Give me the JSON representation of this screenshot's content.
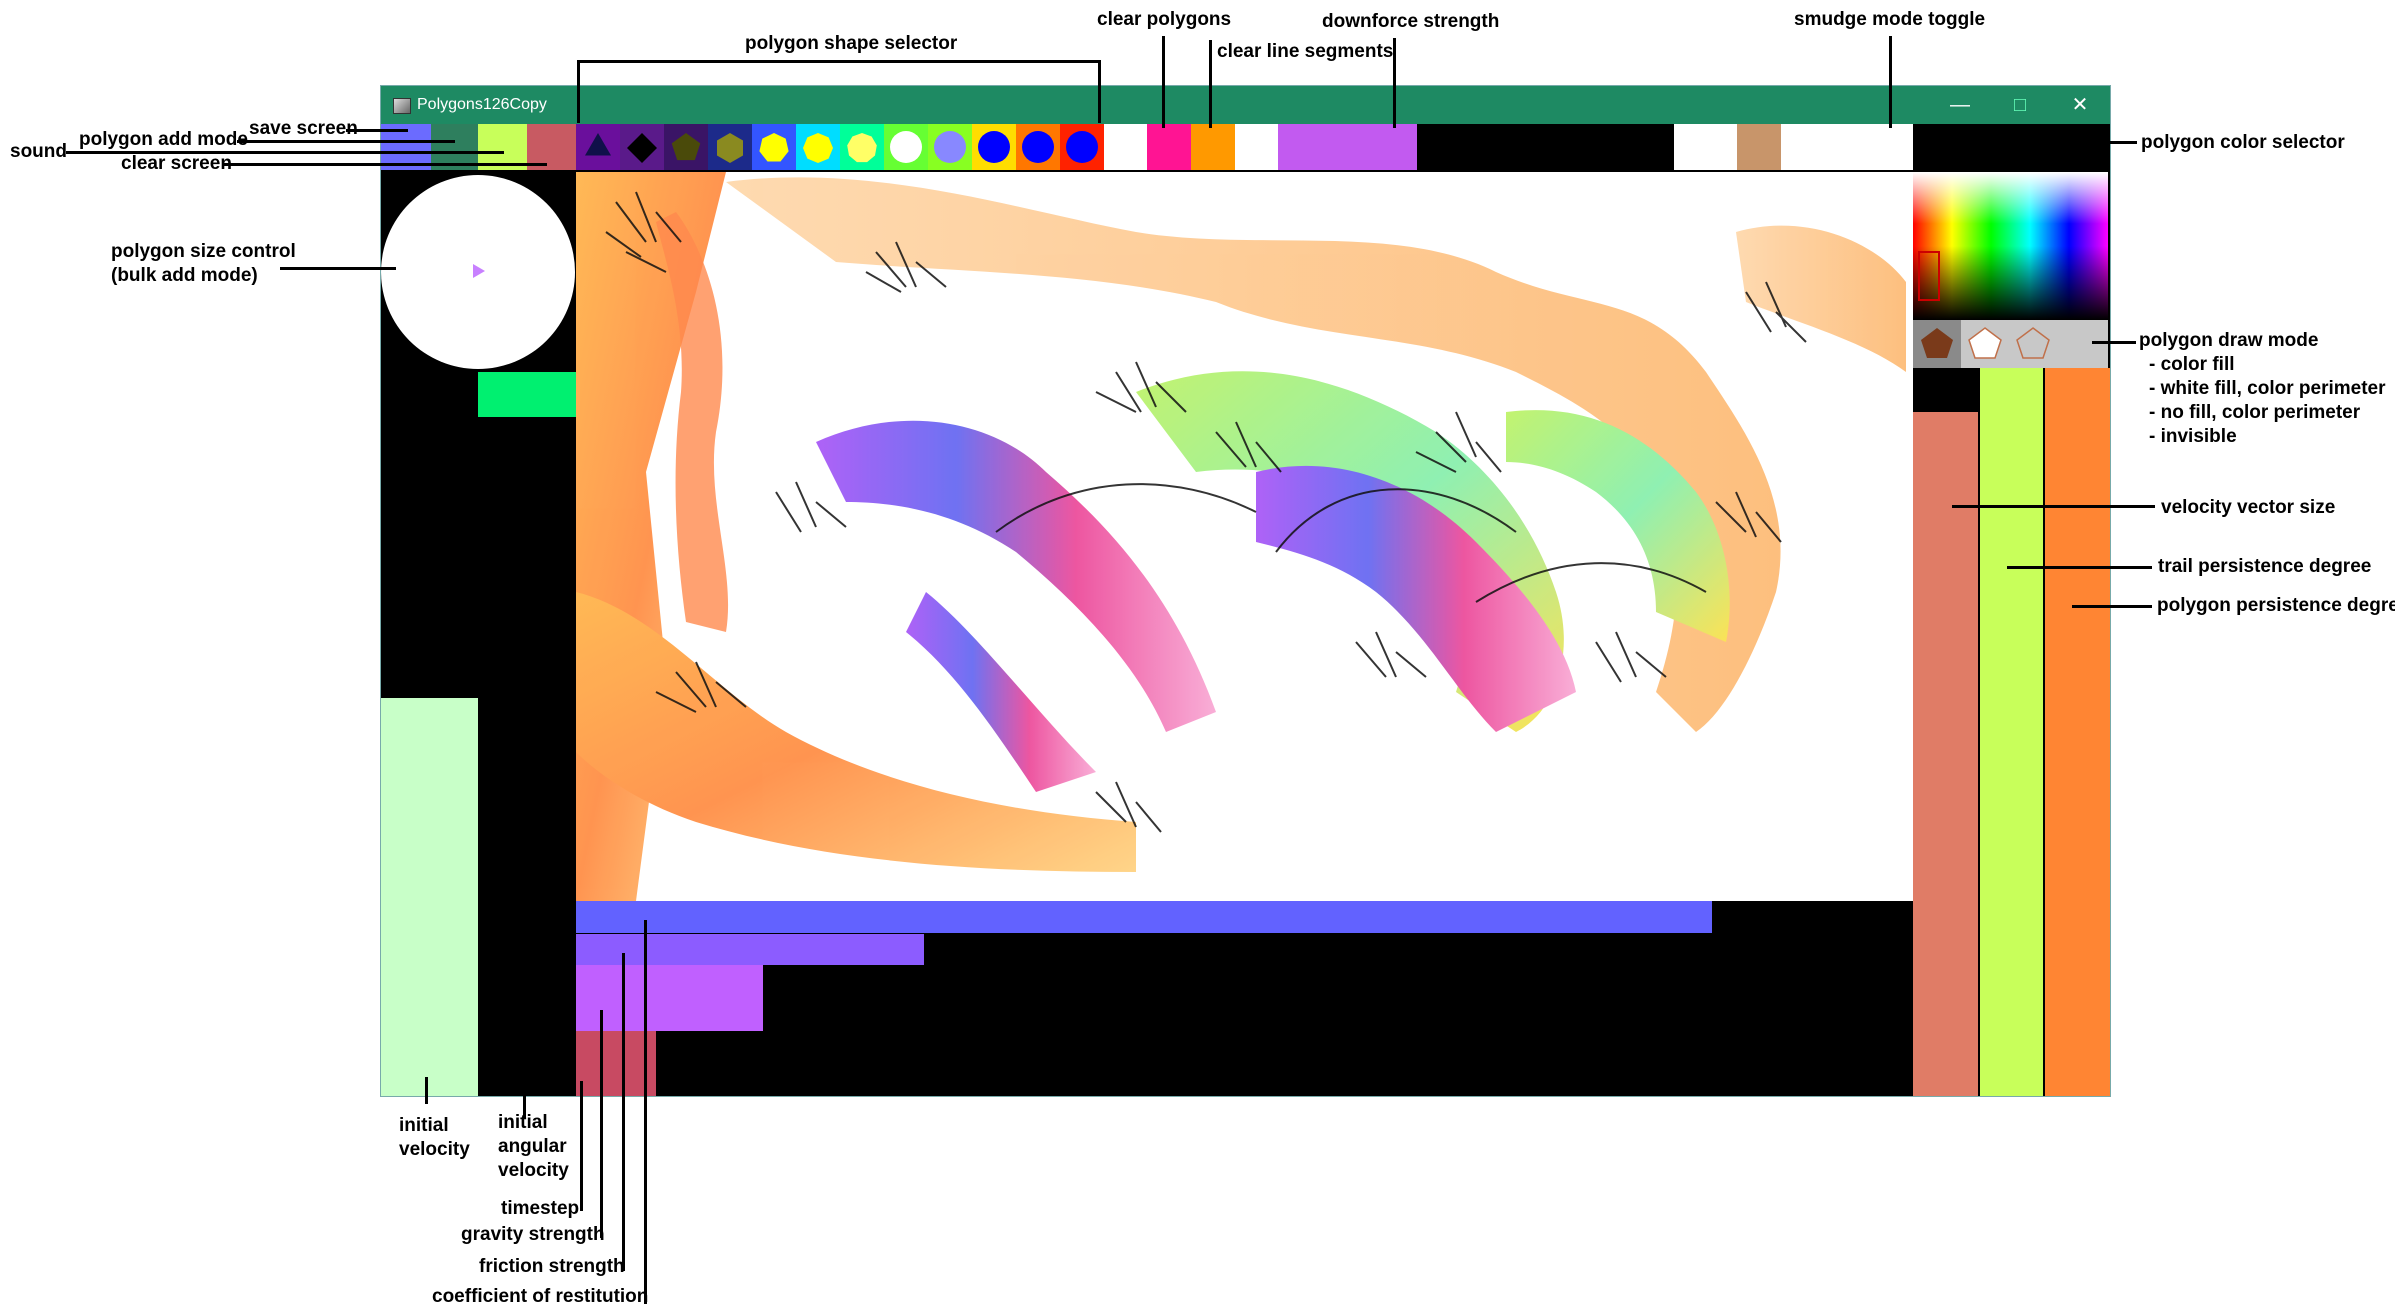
{
  "window": {
    "title": "Polygons126Copy",
    "controls": {
      "minimize": "—",
      "maximize": "□",
      "close": "✕"
    }
  },
  "colors": {
    "titlebar": "#1e8a63",
    "sound": "#6b6bff",
    "polygon_add_mode": "#2e7f5e",
    "save_screen": "#c8ff5a",
    "clear_screen": "#c85a62",
    "clear_polygons": "#ff1493",
    "clear_line_segments": "#ff9900",
    "downforce_strength": "#c25af0",
    "smudge_mode_toggle": "#c8956a",
    "initial_velocity": "#c8ffc8",
    "initial_angular_velocity": "#00f070",
    "coefficient_of_restitution": "#6262ff",
    "friction_strength": "#8c5cff",
    "gravity_strength": "#c060ff",
    "timestep": "#c84a62",
    "velocity_vector_size": "#e07c66",
    "trail_persistence_degree": "#c8ff5a",
    "polygon_persistence_degree": "#ff8533",
    "size_indicator": "#c880ff"
  },
  "shape_selector": [
    {
      "icon": "triangle-icon",
      "bg": "#6a0f9c",
      "fg": "#10104a"
    },
    {
      "icon": "diamond-icon",
      "bg": "#5a1a8a",
      "fg": "#000000"
    },
    {
      "icon": "pentagon-icon",
      "bg": "#3a1466",
      "fg": "#4a4a0a"
    },
    {
      "icon": "hexagon-icon",
      "bg": "#1c2a8a",
      "fg": "#8a8a20"
    },
    {
      "icon": "heptagon-icon",
      "bg": "#3355ff",
      "fg": "#ffff00"
    },
    {
      "icon": "octagon-icon",
      "bg": "#00ddff",
      "fg": "#ffff00"
    },
    {
      "icon": "nonagon-icon",
      "bg": "#00ff99",
      "fg": "#ffff66"
    },
    {
      "icon": "circle-icon",
      "bg": "#66ff33",
      "fg": "#ffffff"
    },
    {
      "icon": "circle-icon",
      "bg": "#88ff22",
      "fg": "#8888ff"
    },
    {
      "icon": "circle-icon",
      "bg": "#ffdd00",
      "fg": "#0000ff"
    },
    {
      "icon": "circle-icon",
      "bg": "#ff7700",
      "fg": "#0000ff"
    },
    {
      "icon": "circle-icon",
      "bg": "#ff2200",
      "fg": "#0000ff"
    }
  ],
  "slider_levels": {
    "downforce_strength": 0.35,
    "coefficient_of_restitution": 0.85,
    "friction_strength": 0.26,
    "gravity_strength": 0.14,
    "timestep": 0.06,
    "initial_velocity": 0.55,
    "initial_angular_velocity": 0.1,
    "velocity_vector_size": 0.94,
    "trail_persistence_degree": 1.0,
    "polygon_persistence_degree": 1.0
  },
  "labels": {
    "polygon_shape_selector": "polygon shape selector",
    "clear_polygons": "clear polygons",
    "clear_line_segments": "clear line segments",
    "downforce_strength": "downforce strength",
    "smudge_mode_toggle": "smudge mode toggle",
    "save_screen": "save screen",
    "polygon_add_mode": "polygon add mode",
    "sound": "sound",
    "clear_screen": "clear screen",
    "polygon_size_control": "polygon size control",
    "bulk_add_mode": "(bulk add mode)",
    "polygon_color_selector": "polygon color selector",
    "polygon_draw_mode": "polygon draw mode",
    "mode_color_fill": "- color fill",
    "mode_white_fill": "- white fill, color perimeter",
    "mode_no_fill": "- no fill, color perimeter",
    "mode_invisible": "- invisible",
    "velocity_vector_size": "velocity vector size",
    "trail_persistence_degree": "trail persistence degree",
    "polygon_persistence_degree": "polygon persistence degree",
    "initial_velocity_1": "initial",
    "initial_velocity_2": "velocity",
    "initial_angular_1": "initial",
    "initial_angular_2": "angular",
    "initial_angular_3": "velocity",
    "timestep": "timestep",
    "gravity_strength": "gravity strength",
    "friction_strength": "friction strength",
    "coefficient_of_restitution": "coefficient of restitution"
  }
}
